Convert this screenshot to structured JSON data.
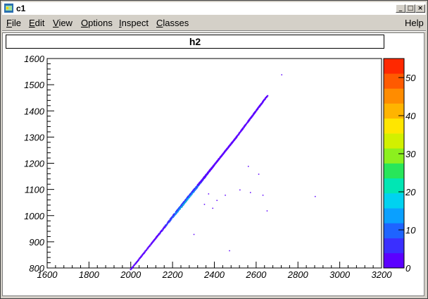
{
  "window": {
    "title": "c1",
    "buttons": {
      "minimize": "_",
      "maximize": "□",
      "close": "×"
    }
  },
  "menu": {
    "items": [
      {
        "label": "File",
        "underline": "F",
        "rest": "ile"
      },
      {
        "label": "Edit",
        "underline": "E",
        "rest": "dit"
      },
      {
        "label": "View",
        "underline": "V",
        "rest": "iew"
      },
      {
        "label": "Options",
        "underline": "O",
        "rest": "ptions"
      },
      {
        "label": "Inspect",
        "underline": "I",
        "rest": "nspect"
      },
      {
        "label": "Classes",
        "underline": "C",
        "rest": "lasses"
      }
    ],
    "help": "Help"
  },
  "chart_data": {
    "type": "heatmap",
    "title": "h2",
    "xlabel": "",
    "ylabel": "",
    "xlim": [
      1600,
      3200
    ],
    "ylim": [
      800,
      1600
    ],
    "xticks": [
      1600,
      1800,
      2000,
      2200,
      2400,
      2600,
      2800,
      3000,
      3200
    ],
    "yticks": [
      800,
      900,
      1000,
      1100,
      1200,
      1300,
      1400,
      1500,
      1600
    ],
    "colorbar": {
      "min": 0,
      "max": 55,
      "ticks": [
        0,
        10,
        20,
        30,
        40,
        50
      ]
    },
    "band": [
      {
        "x": 2000,
        "y": 800
      },
      {
        "x": 2200,
        "y": 1000
      },
      {
        "x": 2300,
        "y": 1100
      },
      {
        "x": 2400,
        "y": 1200
      },
      {
        "x": 2500,
        "y": 1300
      },
      {
        "x": 2650,
        "y": 1460
      }
    ],
    "peak": {
      "x": 2250,
      "y": 1060,
      "value": 25
    },
    "outliers": [
      {
        "x": 2720,
        "y": 1540
      },
      {
        "x": 2880,
        "y": 1075
      },
      {
        "x": 2650,
        "y": 1020
      },
      {
        "x": 2470,
        "y": 868
      },
      {
        "x": 2560,
        "y": 1190
      },
      {
        "x": 2610,
        "y": 1160
      },
      {
        "x": 2520,
        "y": 1100
      },
      {
        "x": 2570,
        "y": 1090
      },
      {
        "x": 2450,
        "y": 1080
      },
      {
        "x": 2410,
        "y": 1060
      },
      {
        "x": 2390,
        "y": 1030
      },
      {
        "x": 2370,
        "y": 1085
      },
      {
        "x": 2630,
        "y": 1080
      },
      {
        "x": 2350,
        "y": 1045
      },
      {
        "x": 2300,
        "y": 930
      }
    ]
  }
}
